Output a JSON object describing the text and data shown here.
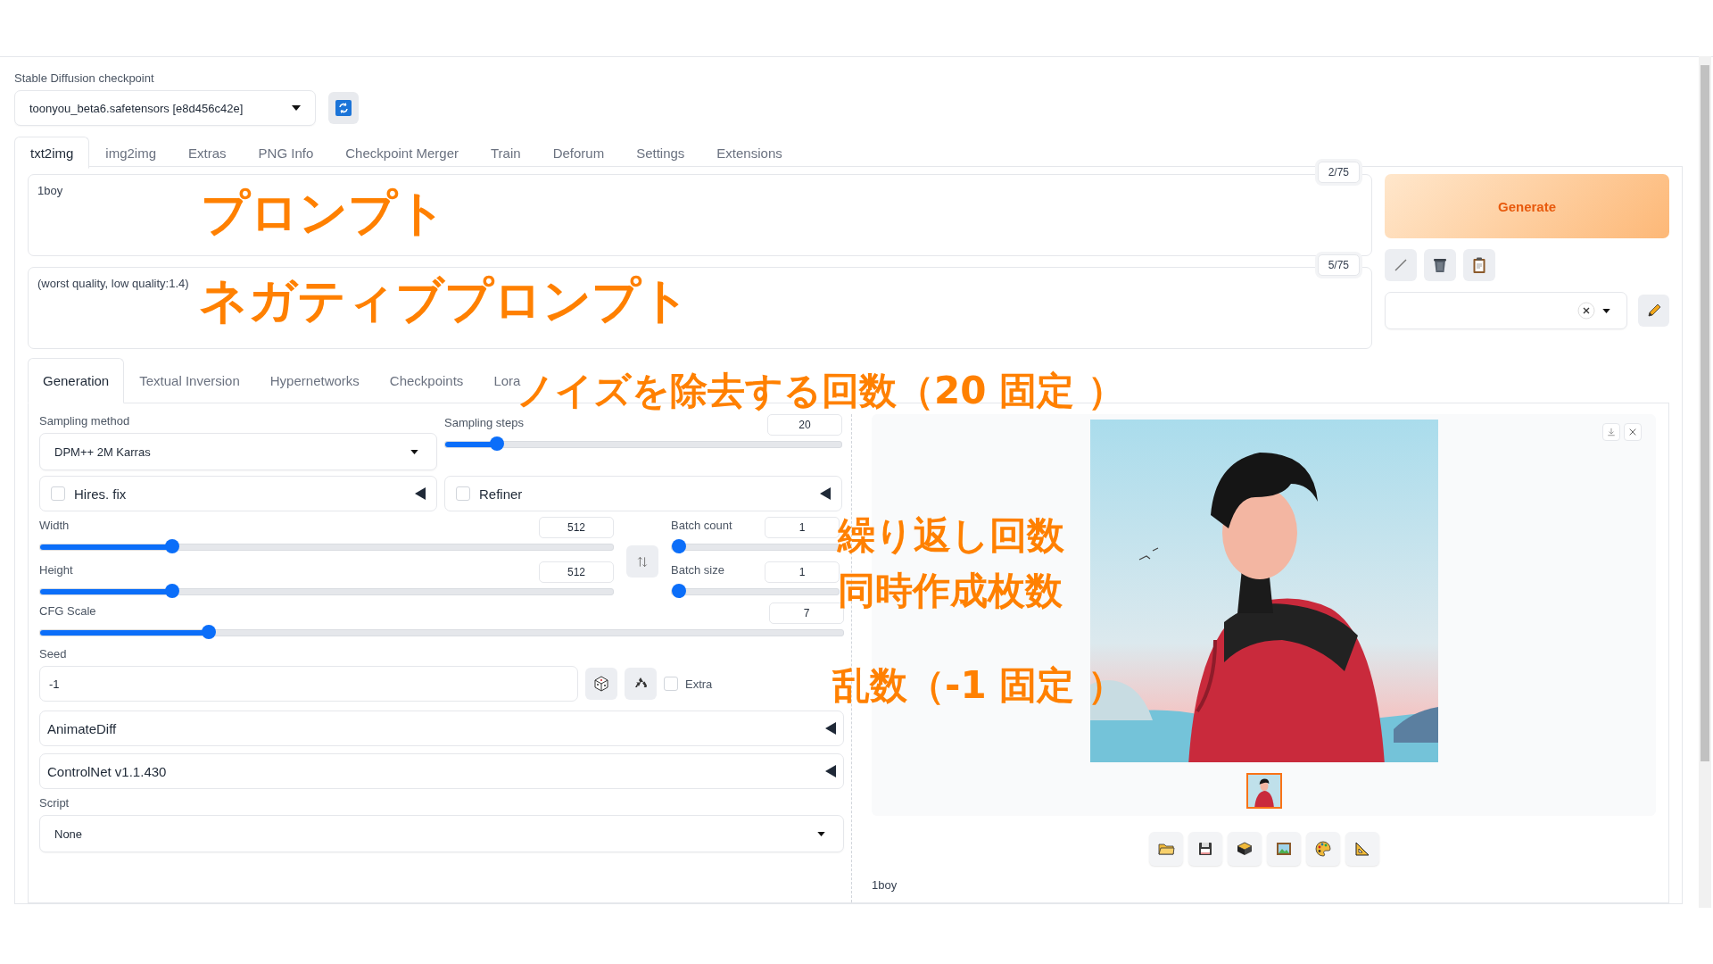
{
  "checkpoint": {
    "label": "Stable Diffusion checkpoint",
    "value": "toonyou_beta6.safetensors [e8d456c42e]"
  },
  "tabs": [
    {
      "label": "txt2img",
      "selected": true
    },
    {
      "label": "img2img",
      "selected": false
    },
    {
      "label": "Extras",
      "selected": false
    },
    {
      "label": "PNG Info",
      "selected": false
    },
    {
      "label": "Checkpoint Merger",
      "selected": false
    },
    {
      "label": "Train",
      "selected": false
    },
    {
      "label": "Deforum",
      "selected": false
    },
    {
      "label": "Settings",
      "selected": false
    },
    {
      "label": "Extensions",
      "selected": false
    }
  ],
  "prompt": {
    "value": "1boy",
    "counter": "2/75",
    "annotation": "プロンプト"
  },
  "negative_prompt": {
    "value": "(worst quality, low quality:1.4)",
    "counter": "5/75",
    "annotation": "ネガティブプロンプト"
  },
  "generate_button": "Generate",
  "sub_tabs": [
    {
      "label": "Generation",
      "selected": true
    },
    {
      "label": "Textual Inversion",
      "selected": false
    },
    {
      "label": "Hypernetworks",
      "selected": false
    },
    {
      "label": "Checkpoints",
      "selected": false
    },
    {
      "label": "Lora",
      "selected": false
    }
  ],
  "sampling_method": {
    "label": "Sampling method",
    "value": "DPM++ 2M Karras"
  },
  "sampling_steps": {
    "label": "Sampling steps",
    "value": "20",
    "level": 0.13,
    "annotation": "ノイズを除去する回数（20 固定 ）"
  },
  "accordions": [
    {
      "label": "Hires. fix",
      "checked": false,
      "expanded": false
    },
    {
      "label": "Refiner",
      "checked": false,
      "expanded": false
    }
  ],
  "width": {
    "label": "Width",
    "value": "512",
    "level": 0.23
  },
  "height": {
    "label": "Height",
    "value": "512",
    "level": 0.23
  },
  "batch_count": {
    "label": "Batch count",
    "value": "1",
    "level": 0.0,
    "annotation": "繰り返し回数"
  },
  "batch_size": {
    "label": "Batch size",
    "value": "1",
    "level": 0.0,
    "annotation": "同時作成枚数"
  },
  "cfg_scale": {
    "label": "CFG Scale",
    "value": "7",
    "level": 0.21
  },
  "seed": {
    "label": "Seed",
    "value": "-1",
    "extra_label": "Extra",
    "extra_checked": false,
    "annotation": "乱数（-1 固定 ）"
  },
  "sections": [
    {
      "label": "AnimateDiff",
      "expanded": false
    },
    {
      "label": "ControlNet v1.1.430",
      "expanded": false
    }
  ],
  "script": {
    "label": "Script",
    "value": "None"
  },
  "output": {
    "caption": "1boy"
  }
}
